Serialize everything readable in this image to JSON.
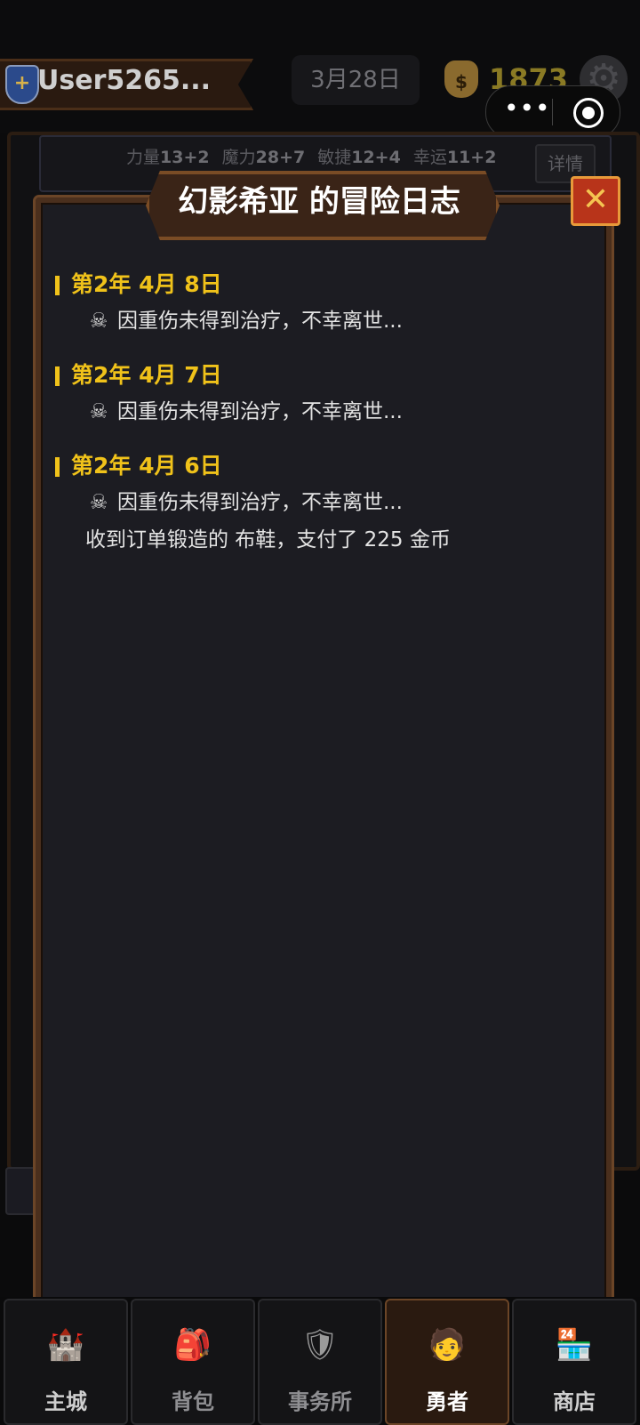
{
  "header": {
    "username": "User5265...",
    "date": "3月28日",
    "gold": "1873",
    "shield_icon": "shield-icon",
    "money_icon": "money-bag-icon",
    "settings_icon": "gear-icon"
  },
  "capsule": {
    "more_glyph": "•••",
    "close_icon": "target-icon"
  },
  "stats": [
    {
      "label": "力量",
      "value": "13+2"
    },
    {
      "label": "魔力",
      "value": "28+7"
    },
    {
      "label": "敏捷",
      "value": "12+4"
    },
    {
      "label": "幸运",
      "value": "11+2"
    }
  ],
  "detail_button": "详情",
  "modal": {
    "title": "幻影希亚 的冒险日志",
    "close_glyph": "✕",
    "entries": [
      {
        "date": "第2年 4月 8日",
        "lines": [
          {
            "icon": "☠",
            "text": "因重伤未得到治疗，不幸离世..."
          }
        ]
      },
      {
        "date": "第2年 4月 7日",
        "lines": [
          {
            "icon": "☠",
            "text": "因重伤未得到治疗，不幸离世..."
          }
        ]
      },
      {
        "date": "第2年 4月 6日",
        "lines": [
          {
            "icon": "☠",
            "text": "因重伤未得到治疗，不幸离世..."
          },
          {
            "icon": "",
            "text": "收到订单锻造的 布鞋，支付了 225 金币"
          }
        ]
      }
    ]
  },
  "nav": [
    {
      "label": "主城",
      "icon": "castle-icon",
      "glyph": "🏰",
      "active": false
    },
    {
      "label": "背包",
      "icon": "bag-icon",
      "glyph": "🎒",
      "active": false
    },
    {
      "label": "事务所",
      "icon": "guild-shield-icon",
      "glyph": "🛡",
      "active": false
    },
    {
      "label": "勇者",
      "icon": "hero-icon",
      "glyph": "🧑",
      "active": true
    },
    {
      "label": "商店",
      "icon": "shop-icon",
      "glyph": "🏪",
      "active": false
    }
  ],
  "colors": {
    "accent_gold": "#f0c21a",
    "frame_brown": "#4a2f1d",
    "close_red": "#b8341a"
  }
}
